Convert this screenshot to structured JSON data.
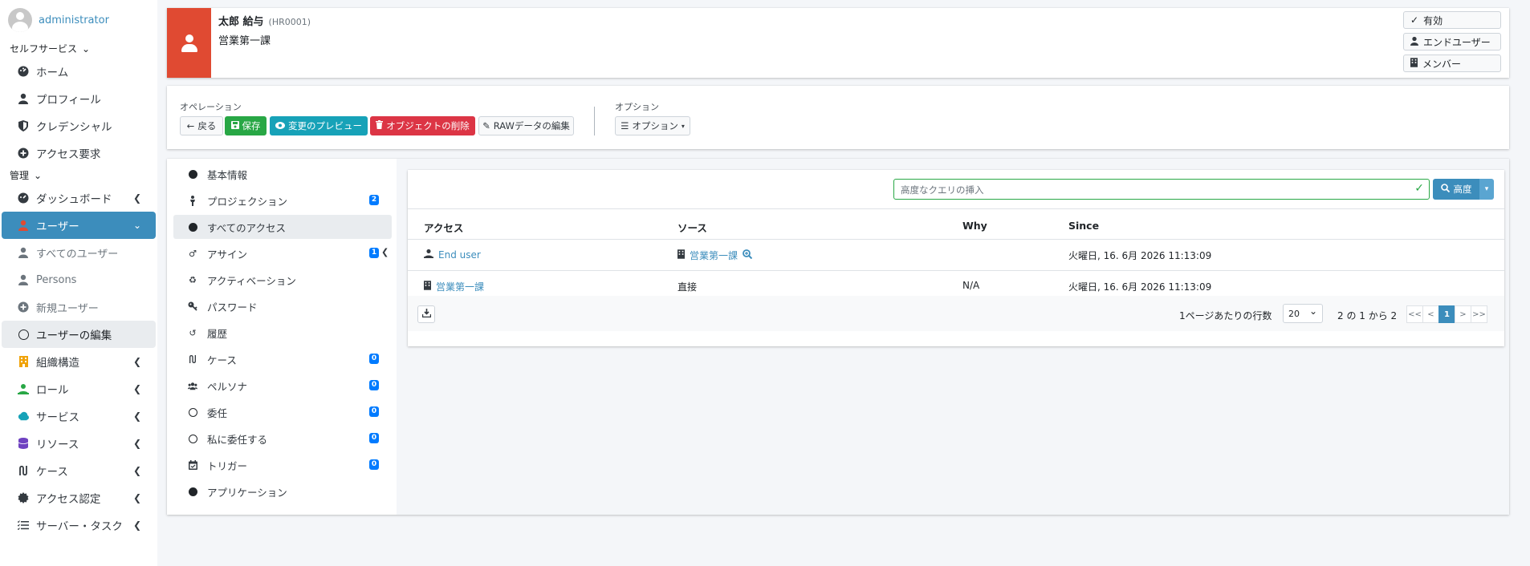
{
  "sidebar": {
    "username": "administrator",
    "section_selfservice": "セルフサービス",
    "section_admin": "管理",
    "selfservice_items": [
      {
        "label": "ホーム"
      },
      {
        "label": "プロフィール"
      },
      {
        "label": "クレデンシャル"
      },
      {
        "label": "アクセス要求"
      }
    ],
    "admin_items": [
      {
        "label": "ダッシュボード"
      },
      {
        "label": "ユーザー"
      },
      {
        "label": "すべてのユーザー"
      },
      {
        "label": "Persons"
      },
      {
        "label": "新規ユーザー"
      },
      {
        "label": "ユーザーの編集"
      },
      {
        "label": "組織構造"
      },
      {
        "label": "ロール"
      },
      {
        "label": "サービス"
      },
      {
        "label": "リソース"
      },
      {
        "label": "ケース"
      },
      {
        "label": "アクセス認定"
      },
      {
        "label": "サーバー・タスク"
      }
    ]
  },
  "header": {
    "name": "太郎 給与",
    "code": "(HR0001)",
    "org": "営業第一課",
    "tags": [
      "有効",
      "エンドユーザー",
      "メンバー"
    ]
  },
  "operations": {
    "label": "オペレーション",
    "back": "戻る",
    "save": "保存",
    "preview": "変更のプレビュー",
    "delete": "オブジェクトの削除",
    "raw": "RAWデータの編集",
    "options_label": "オプション",
    "options": "オプション"
  },
  "tabs": [
    {
      "label": "基本情報",
      "badge": ""
    },
    {
      "label": "プロジェクション",
      "badge": "2"
    },
    {
      "label": "すべてのアクセス",
      "badge": ""
    },
    {
      "label": "アサイン",
      "badge": "1"
    },
    {
      "label": "アクティベーション",
      "badge": ""
    },
    {
      "label": "パスワード",
      "badge": ""
    },
    {
      "label": "履歴",
      "badge": ""
    },
    {
      "label": "ケース",
      "badge": "0"
    },
    {
      "label": "ペルソナ",
      "badge": "0"
    },
    {
      "label": "委任",
      "badge": "0"
    },
    {
      "label": "私に委任する",
      "badge": "0"
    },
    {
      "label": "トリガー",
      "badge": "0"
    },
    {
      "label": "アプリケーション",
      "badge": ""
    }
  ],
  "search": {
    "placeholder": "高度なクエリの挿入",
    "advanced": "高度"
  },
  "table": {
    "headers": [
      "アクセス",
      "ソース",
      "Why",
      "Since"
    ],
    "rows": [
      {
        "access": "End user",
        "source": "営業第一課",
        "why": "",
        "since": "火曜日, 16. 6月 2026 11:13:09"
      },
      {
        "access": "営業第一課",
        "source": "直接",
        "why": "N/A",
        "since": "火曜日, 16. 6月 2026 11:13:09"
      }
    ]
  },
  "pagination": {
    "rows_label": "1ページあたりの行数",
    "rows_value": "20",
    "range": "2 の 1 から 2",
    "buttons": [
      "<<",
      "<",
      "1",
      ">",
      ">>"
    ]
  },
  "colors": {
    "accent": "#3c8dbc",
    "header_icon_bg": "#e04a32",
    "success": "#28a745",
    "info": "#17a2b8",
    "danger": "#dc3545"
  }
}
